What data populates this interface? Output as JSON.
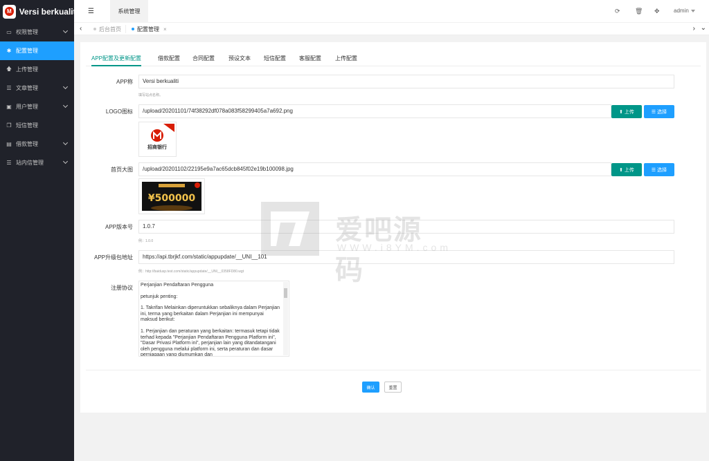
{
  "app": {
    "title": "Versi berkualiti",
    "logo_letter": "M"
  },
  "sidebar": {
    "items": [
      {
        "label": "权限管理",
        "icon": "monitor-icon",
        "glyph": "▭",
        "active": false,
        "has_children": true
      },
      {
        "label": "配置管理",
        "icon": "gear-icon",
        "glyph": "✱",
        "active": true,
        "has_children": false
      },
      {
        "label": "上传管理",
        "icon": "upload-icon",
        "glyph": "🡅",
        "active": false,
        "has_children": false
      },
      {
        "label": "文章管理",
        "icon": "list-icon",
        "glyph": "☰",
        "active": false,
        "has_children": true
      },
      {
        "label": "用户管理",
        "icon": "user-icon",
        "glyph": "▣",
        "active": false,
        "has_children": true
      },
      {
        "label": "短信管理",
        "icon": "copy-icon",
        "glyph": "❐",
        "active": false,
        "has_children": false
      },
      {
        "label": "借款管理",
        "icon": "wallet-icon",
        "glyph": "▤",
        "active": false,
        "has_children": true
      },
      {
        "label": "站内信管理",
        "icon": "list-icon",
        "glyph": "☰",
        "active": false,
        "has_children": true
      }
    ]
  },
  "header": {
    "menu_icon": "menu-icon",
    "top_tab": "系统管理",
    "icons": [
      "refresh-icon",
      "trash-icon",
      "fullscreen-icon"
    ],
    "user": "admin"
  },
  "tabstrip": {
    "tabs": [
      {
        "label": "后台首页",
        "active": false
      },
      {
        "label": "配置管理",
        "active": true,
        "close": "×"
      }
    ]
  },
  "form_tabs": [
    "APP配置及更新配置",
    "借款配置",
    "合同配置",
    "预设文本",
    "短信配置",
    "客服配置",
    "上传配置"
  ],
  "form": {
    "app_name": {
      "label": "APP称",
      "value": "Versi berkualiti",
      "hint": "填写站点名称。"
    },
    "logo": {
      "label": "LOGO图标",
      "value": "/upload/20201101/74f38292df078a083f58299405a7a692.png",
      "upload_label": "上传",
      "select_label": "选择",
      "preview_text": "招商银行"
    },
    "banner": {
      "label": "首页大图",
      "value": "/upload/20201102/22195e9a7ac65dcb845f02e19b100098.jpg",
      "upload_label": "上传",
      "select_label": "选择",
      "preview_text": "¥500000"
    },
    "version": {
      "label": "APP版本号",
      "value": "1.0.7",
      "hint": "例：1.0.0"
    },
    "upgrade_url": {
      "label": "APP升级包地址",
      "value": "https://api.tbrjkf.com/static/appupdate/__UNI__101",
      "hint": "例：http://baidusp.test.com/static/appupdate/__UNI__0358FD80.wgt"
    },
    "agreement": {
      "label": "注册协议",
      "paragraphs": [
        "Perjanjian Pendaftaran Pengguna",
        "petunjuk penting:",
        "1. Takrifan Melainkan diperuntukkan sebaliknya dalam Perjanjian ini, terma yang berkaitan dalam Perjanjian ini mempunyai maksud berikut:",
        "1. Perjanjian dan peraturan yang berkaitan: termasuk tetapi tidak terhad kepada \"Perjanjian Pendaftaran Pengguna Platform ini\", \"Dasar Privasi Platform ini\", perjanjian lain yang ditandatangani oleh pengguna melalui platform ini, serta peraturan dan dasar perniagaan yang diumumkan dan"
      ]
    },
    "submit_label": "确认",
    "reset_label": "重置"
  },
  "watermark": {
    "cn": "爱吧源码",
    "en": "WWW.i8YM.com"
  }
}
